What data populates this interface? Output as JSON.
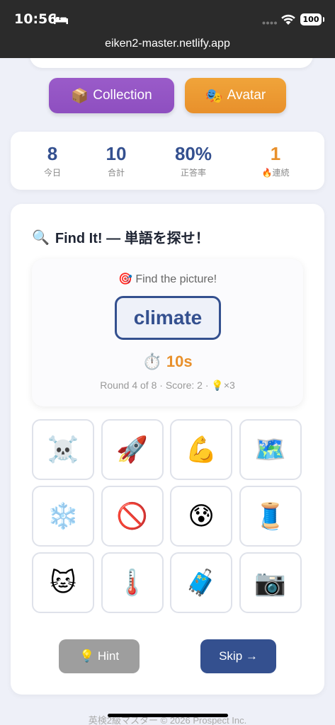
{
  "status_bar": {
    "time": "10:56",
    "battery": "100",
    "url": "eiken2-master.netlify.app"
  },
  "nav_buttons": {
    "collection": {
      "icon": "📦",
      "label": "Collection"
    },
    "avatar": {
      "icon": "🎭",
      "label": "Avatar"
    }
  },
  "stats": [
    {
      "value": "8",
      "label": "今日"
    },
    {
      "value": "10",
      "label": "合計"
    },
    {
      "value": "80%",
      "label": "正答率"
    },
    {
      "value": "1",
      "label": "🔥連続"
    }
  ],
  "game": {
    "title_icon": "🔍",
    "title": "Find It! — 単語を探せ！",
    "prompt": "🎯 Find the picture!",
    "word": "climate",
    "timer": "⏱️ 10s",
    "round_info": "Round 4 of 8 · Score: 2 · 💡×3",
    "tiles": [
      {
        "emoji": "☠️",
        "name": "skull-crossbones"
      },
      {
        "emoji": "🚀",
        "name": "rocket"
      },
      {
        "emoji": "💪",
        "name": "flexed-biceps"
      },
      {
        "emoji": "🗺️",
        "name": "world-map"
      },
      {
        "emoji": "❄️",
        "name": "snowflake"
      },
      {
        "emoji": "🚫",
        "name": "prohibited"
      },
      {
        "emoji": "😰",
        "name": "anxious-face"
      },
      {
        "emoji": "🧵",
        "name": "thread-spool"
      },
      {
        "emoji": "🐱",
        "name": "cat-face"
      },
      {
        "emoji": "🌡️",
        "name": "thermometer"
      },
      {
        "emoji": "🧳",
        "name": "luggage"
      },
      {
        "emoji": "📷",
        "name": "camera"
      }
    ],
    "hint_label": "💡 Hint",
    "skip_label": "Skip →"
  },
  "footer": "英検2級マスター © 2026 Prospect Inc.",
  "colors": {
    "primary": "#34508f",
    "accent_orange": "#e8902b",
    "purple": "#8e4fc0",
    "hint_gray": "#9e9e9e",
    "background": "#eef0f8"
  }
}
